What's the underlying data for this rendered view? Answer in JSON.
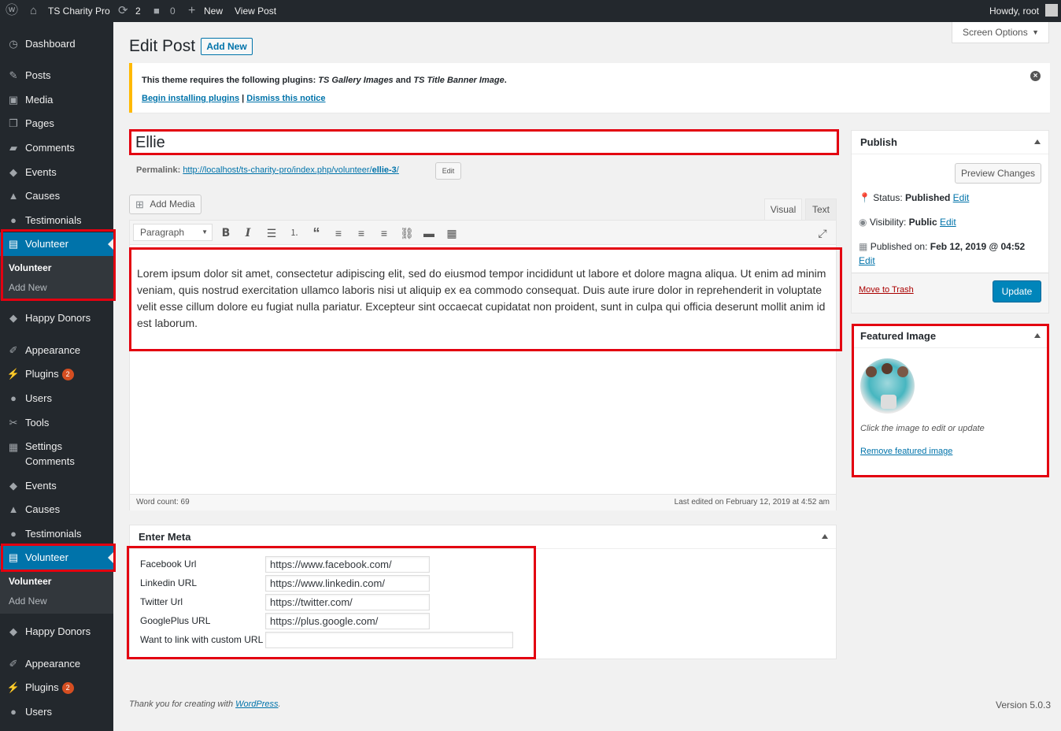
{
  "adminbar": {
    "site_name": "TS Charity Pro",
    "updates_count": "2",
    "comments_count": "0",
    "new_label": "New",
    "view_post_label": "View Post",
    "howdy": "Howdy, root"
  },
  "sidebar": {
    "items1": [
      {
        "label": "Dashboard",
        "icon": "dashboard-icon"
      },
      {
        "label": "Posts",
        "icon": "pin-icon"
      },
      {
        "label": "Media",
        "icon": "media-icon"
      },
      {
        "label": "Pages",
        "icon": "pages-icon"
      },
      {
        "label": "Comments",
        "icon": "comment-icon"
      },
      {
        "label": "Events",
        "icon": "tag-icon"
      },
      {
        "label": "Causes",
        "icon": "cap-icon"
      },
      {
        "label": "Testimonials",
        "icon": "users-icon"
      },
      {
        "label": "Volunteer",
        "icon": "page-icon"
      }
    ],
    "sub1": {
      "current": "Volunteer",
      "add_new": "Add New"
    },
    "items2": [
      {
        "label": "Happy Donors",
        "icon": "tag-icon"
      },
      {
        "label": "Appearance",
        "icon": "brush-icon"
      },
      {
        "label": "Plugins",
        "icon": "plug-icon",
        "badge": "2"
      },
      {
        "label": "Users",
        "icon": "user-icon"
      },
      {
        "label": "Tools",
        "icon": "wrench-icon"
      },
      {
        "label": "Settings",
        "label2": "Comments",
        "icon": "settings-icon"
      },
      {
        "label": "Events",
        "icon": "tag-icon"
      },
      {
        "label": "Causes",
        "icon": "cap-icon"
      },
      {
        "label": "Testimonials",
        "icon": "users-icon"
      },
      {
        "label": "Volunteer",
        "icon": "page-icon"
      }
    ],
    "sub2": {
      "current": "Volunteer",
      "add_new": "Add New"
    },
    "items3": [
      {
        "label": "Happy Donors",
        "icon": "tag-icon"
      },
      {
        "label": "Appearance",
        "icon": "brush-icon"
      },
      {
        "label": "Plugins",
        "icon": "plug-icon",
        "badge": "2"
      },
      {
        "label": "Users",
        "icon": "user-icon"
      }
    ]
  },
  "screen_options": "Screen Options",
  "page": {
    "title": "Edit Post",
    "add_new": "Add New"
  },
  "notice": {
    "text_a": "This theme requires the following plugins: ",
    "plugin1": "TS Gallery Images",
    "and": " and ",
    "plugin2": "TS Title Banner Image",
    "period": ".",
    "install_link": "Begin installing plugins",
    "sep": " | ",
    "dismiss_link": "Dismiss this notice"
  },
  "post": {
    "title": "Ellie",
    "permalink_label": "Permalink: ",
    "permalink_base": "http://localhost/ts-charity-pro/index.php/volunteer/",
    "permalink_slug": "ellie-3",
    "permalink_end": "/",
    "permalink_edit": "Edit"
  },
  "editor": {
    "add_media": "Add Media",
    "tab_visual": "Visual",
    "tab_text": "Text",
    "format_select": "Paragraph",
    "content": "Lorem ipsum dolor sit amet, consectetur adipiscing elit, sed do eiusmod tempor incididunt ut labore et dolore magna aliqua. Ut enim ad minim veniam, quis nostrud exercitation ullamco laboris nisi ut aliquip ex ea commodo consequat. Duis aute irure dolor in reprehenderit in voluptate velit esse cillum dolore eu fugiat nulla pariatur. Excepteur sint occaecat cupidatat non proident, sunt in culpa qui officia deserunt mollit anim id est laborum.",
    "word_count": "Word count: 69",
    "last_edited": "Last edited on February 12, 2019 at 4:52 am"
  },
  "meta": {
    "title": "Enter Meta",
    "fields": [
      {
        "label": "Facebook Url",
        "value": "https://www.facebook.com/"
      },
      {
        "label": "Linkedin URL",
        "value": "https://www.linkedin.com/"
      },
      {
        "label": "Twitter Url",
        "value": "https://twitter.com/"
      },
      {
        "label": "GooglePlus URL",
        "value": "https://plus.google.com/"
      },
      {
        "label": "Want to link with custom URL",
        "value": ""
      }
    ]
  },
  "publish": {
    "title": "Publish",
    "preview": "Preview Changes",
    "status_label": "Status: ",
    "status_value": "Published",
    "visibility_label": "Visibility: ",
    "visibility_value": "Public",
    "published_label": "Published on: ",
    "published_value": "Feb 12, 2019 @ 04:52",
    "edit": "Edit",
    "trash": "Move to Trash",
    "update": "Update"
  },
  "featured": {
    "title": "Featured Image",
    "hint": "Click the image to edit or update",
    "remove": "Remove featured image"
  },
  "footer": {
    "thanks_a": "Thank you for creating with ",
    "wp_link": "WordPress",
    "thanks_b": ".",
    "version": "Version 5.0.3"
  }
}
